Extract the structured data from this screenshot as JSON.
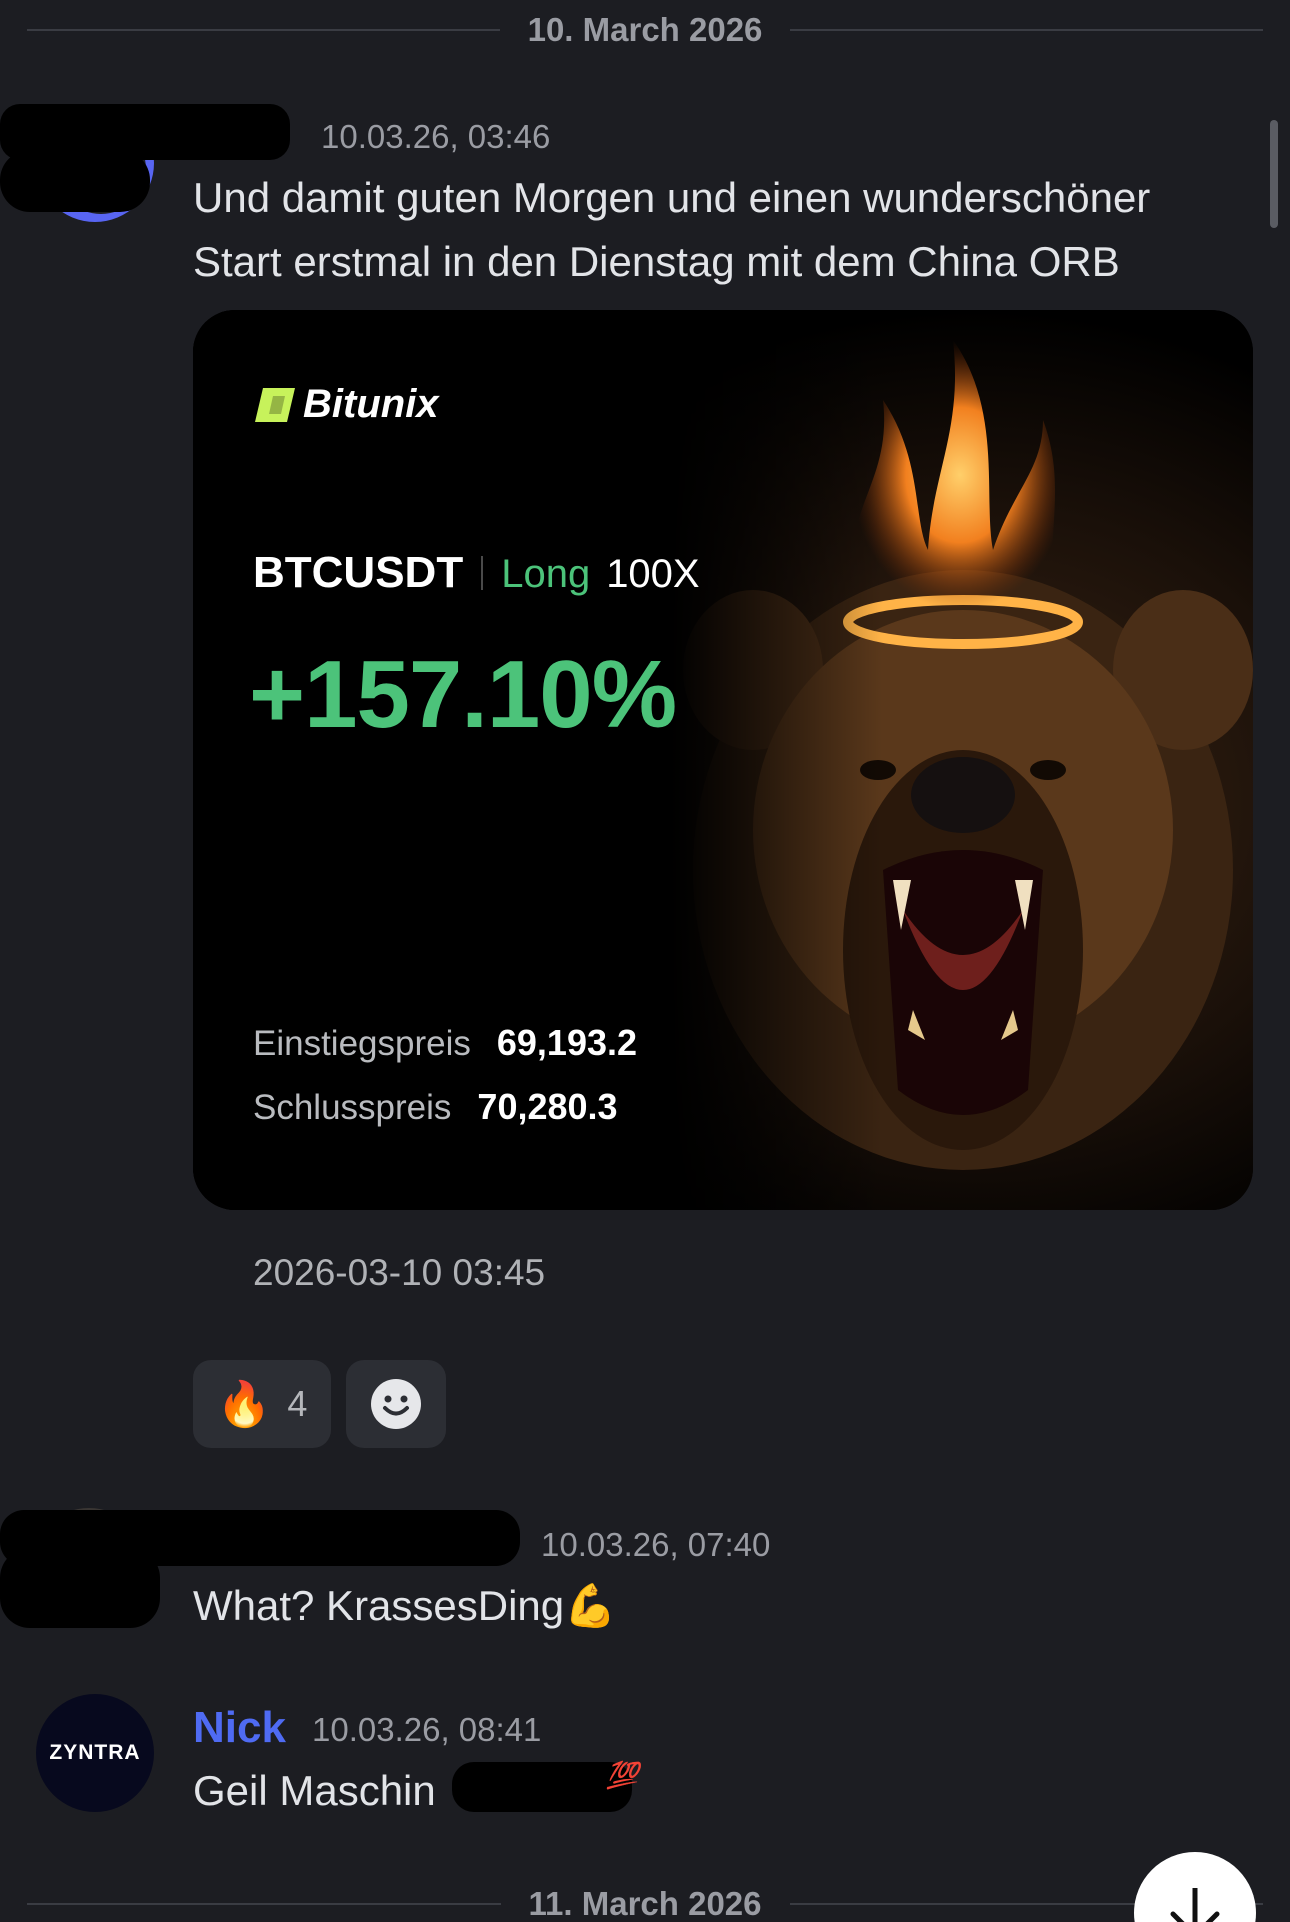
{
  "dividers": {
    "first": "10. March 2026",
    "second": "11. March 2026"
  },
  "messages": [
    {
      "author": "",
      "timestamp": "10.03.26, 03:46",
      "lines": [
        "Und damit guten Morgen und einen wunderschöner",
        "Start erstmal in den Dienstag mit dem China ORB"
      ],
      "attachment": {
        "brand": "Bitunix",
        "pair": "BTCUSDT",
        "side": "Long",
        "leverage": "100X",
        "pnl": "+157.10%",
        "entry_label": "Einstiegspreis",
        "entry_value": "69,193.2",
        "exit_label": "Schlusspreis",
        "exit_value": "70,280.3",
        "date": "2026-03-10 03:45"
      },
      "reactions": [
        {
          "emoji": "🔥",
          "icon": "fire-icon",
          "count": "4"
        },
        {
          "icon": "add-reaction-smiley-icon"
        }
      ]
    },
    {
      "author": "",
      "timestamp": "10.03.26, 07:40",
      "text": "What? KrassesDing💪"
    },
    {
      "author": "Nick",
      "avatar_text": "ZYNTRA",
      "timestamp": "10.03.26, 08:41",
      "text": "Geil Maschin"
    }
  ],
  "colors": {
    "background": "#1c1d22",
    "author_nick": "#4f6bf3",
    "profit_green": "#4cc37a",
    "brand_green": "#c7f25b"
  },
  "icons": {
    "scroll_down": "arrow-down-icon"
  }
}
